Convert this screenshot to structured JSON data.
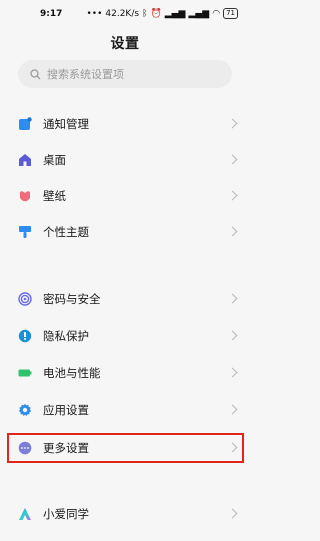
{
  "status_bar": {
    "time": "9:17",
    "net_speed": "42.2K/s",
    "battery": "71"
  },
  "header": {
    "title": "设置"
  },
  "search": {
    "placeholder": "搜索系统设置项"
  },
  "group1": [
    {
      "label": "通知管理",
      "icon": "notification-icon",
      "color": "#2d8cf0"
    },
    {
      "label": "桌面",
      "icon": "home-icon",
      "color": "#5b5bd6"
    },
    {
      "label": "壁纸",
      "icon": "wallpaper-icon",
      "color": "#f06b7c"
    },
    {
      "label": "个性主题",
      "icon": "theme-icon",
      "color": "#2d8cf0"
    }
  ],
  "group2": [
    {
      "label": "密码与安全",
      "icon": "password-security-icon",
      "color": "#6b6bf0"
    },
    {
      "label": "隐私保护",
      "icon": "privacy-icon",
      "color": "#1e90d6"
    },
    {
      "label": "电池与性能",
      "icon": "battery-icon",
      "color": "#2fc36b"
    },
    {
      "label": "应用设置",
      "icon": "app-settings-icon",
      "color": "#2d8cf0"
    },
    {
      "label": "更多设置",
      "icon": "more-settings-icon",
      "color": "#7d7dd8"
    }
  ],
  "group3": [
    {
      "label": "小爱同学",
      "icon": "xiaoai-icon",
      "color": "#3a7bf5"
    }
  ],
  "highlight_color": "#e1251b"
}
